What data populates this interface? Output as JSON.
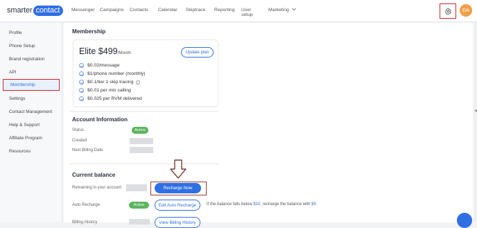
{
  "brand": {
    "text_left": "smarter",
    "text_right": "contact",
    "accent": "#2f6fe4"
  },
  "nav": {
    "items": [
      "Messenger",
      "Campaigns",
      "Contacts",
      "Calendar",
      "Skiptrace",
      "Reporting",
      "User setup",
      "Marketing"
    ],
    "more_chevron_icon": "chevron-down-icon"
  },
  "header": {
    "settings_icon": "gear-icon",
    "avatar_initials": "DA"
  },
  "sidebar": {
    "items": [
      "Profile",
      "Phone Setup",
      "Brand registration",
      "API",
      "Membership",
      "Settings",
      "Contact Management",
      "Help & Support",
      "Affiliate Program",
      "Resources"
    ],
    "active_index": 4
  },
  "membership": {
    "title": "Membership",
    "plan": {
      "name": "Elite $499",
      "period": "/Month"
    },
    "update_label": "Update plan",
    "features": [
      "$0.02/message",
      "$1/phone number (monthly)",
      "$0.1/tier 1 skip tracing",
      "$0.01 per min calling",
      "$0.025 per RVM delivered"
    ]
  },
  "account": {
    "title": "Account Information",
    "status_label": "Status",
    "status_value": "Active",
    "created_label": "Created",
    "next_billing_label": "Next Billing Date"
  },
  "balance": {
    "title": "Current balance",
    "remaining_label": "Remaining in your account",
    "recharge_label": "Recharge Now",
    "auto_label": "Auto Recharge",
    "auto_status": "Active",
    "edit_auto_label": "Edit Auto Recharge",
    "auto_text_before": "If the balance falls below ",
    "threshold": "$10",
    "auto_text_middle": ", recharge the balance with ",
    "amount": "$5",
    "billing_label": "Billing History",
    "view_billing_label": "View Billing History"
  },
  "colors": {
    "highlight_red": "#d0232a",
    "active_green": "#5bb55f"
  }
}
